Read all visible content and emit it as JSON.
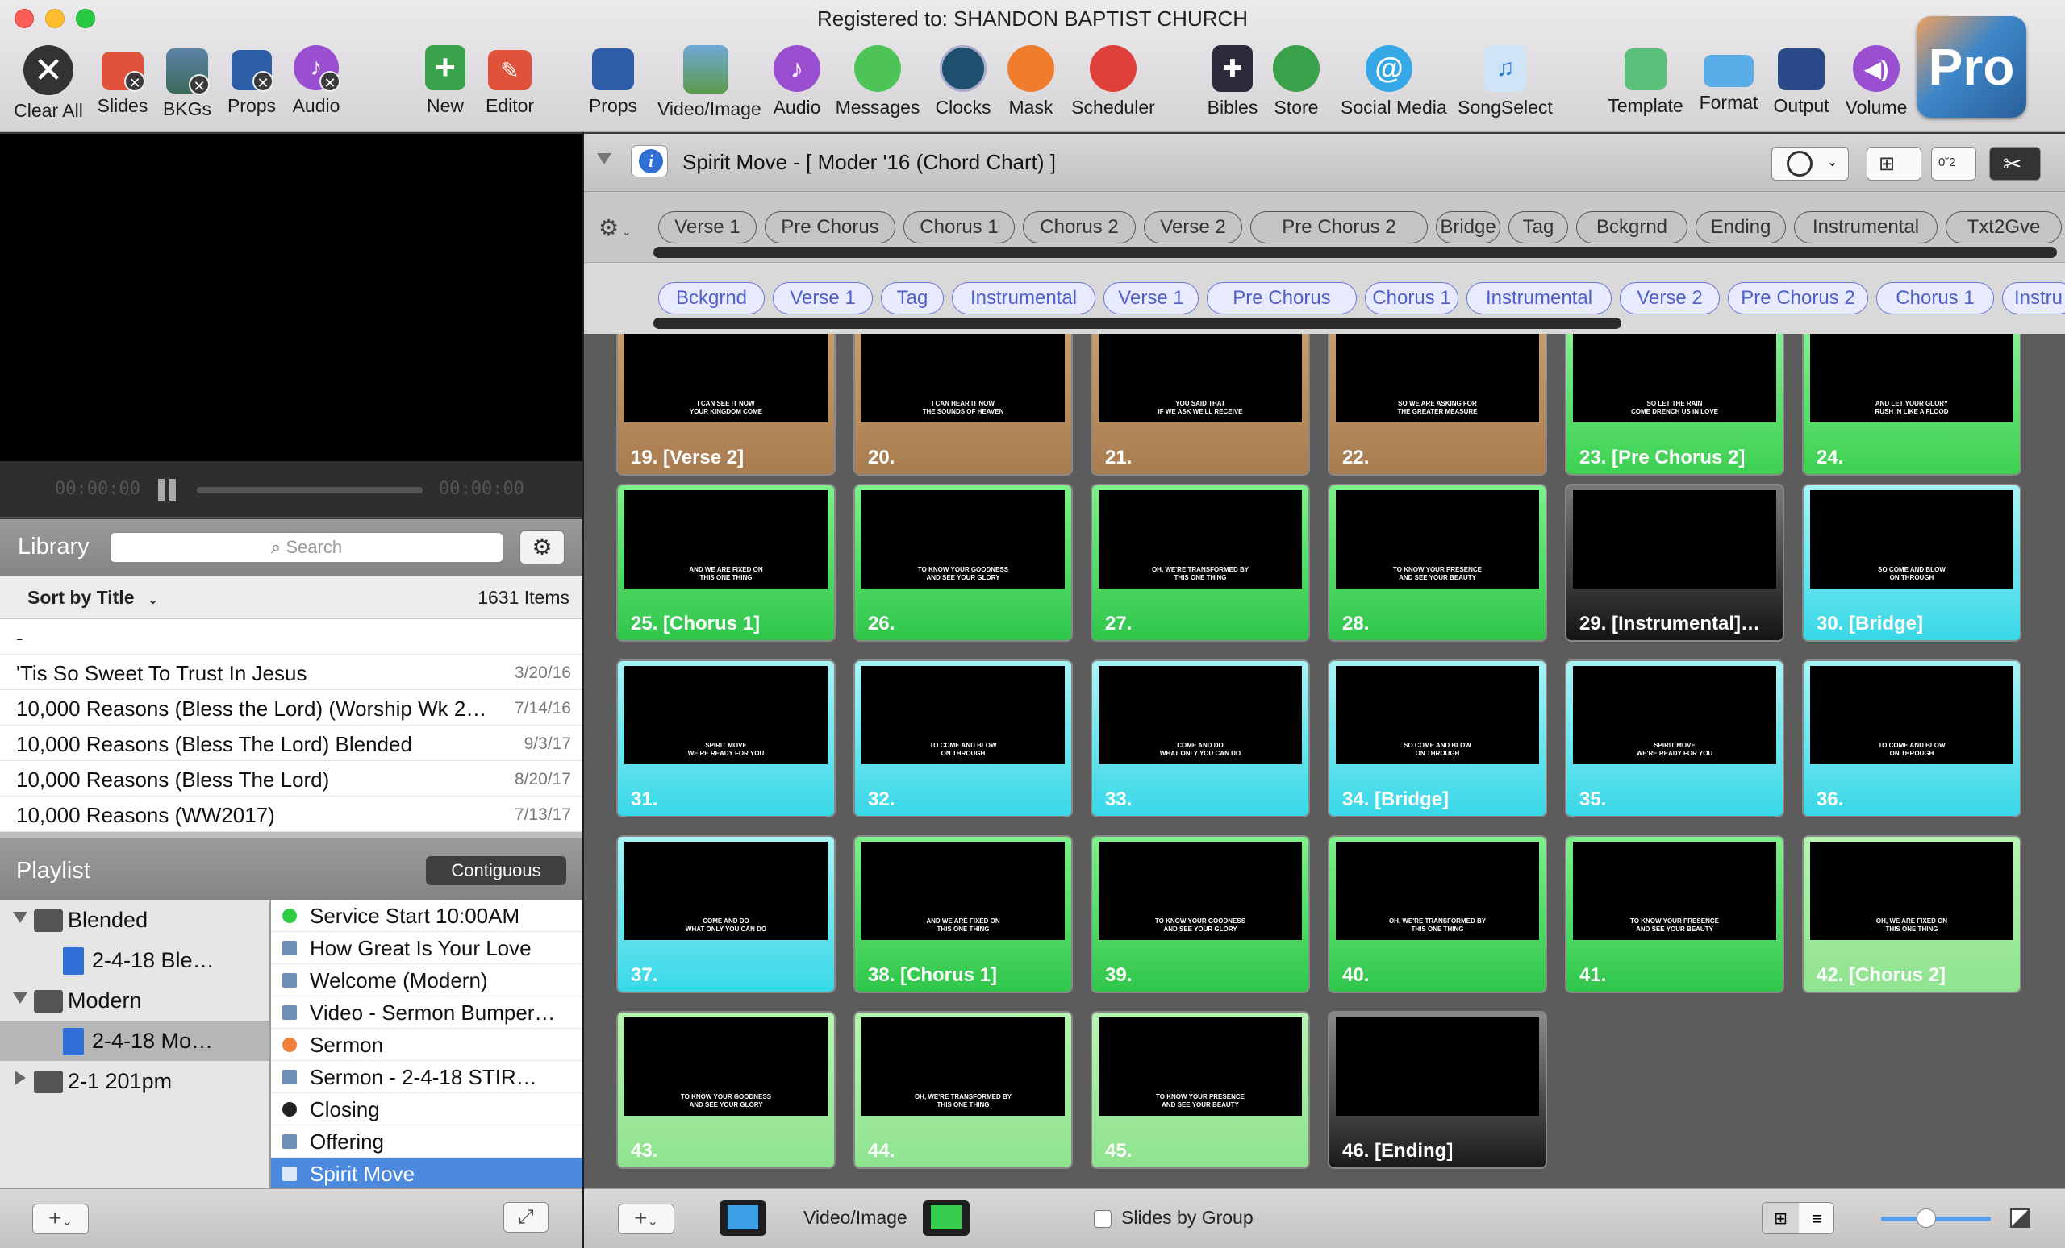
{
  "window": {
    "title": "Registered to: SHANDON BAPTIST CHURCH",
    "brand": "Pro"
  },
  "toolbar": {
    "clear_all": "Clear All",
    "slides": "Slides",
    "bkgs": "BKGs",
    "props": "Props",
    "audio": "Audio",
    "new": "New",
    "editor": "Editor",
    "props2": "Props",
    "video_image": "Video/Image",
    "audio2": "Audio",
    "messages": "Messages",
    "clocks": "Clocks",
    "mask": "Mask",
    "scheduler": "Scheduler",
    "bibles": "Bibles",
    "store": "Store",
    "social_media": "Social Media",
    "songselect": "SongSelect",
    "template": "Template",
    "format": "Format",
    "output": "Output",
    "volume": "Volume"
  },
  "transport": {
    "time_left": "00:00:00",
    "time_right": "00:00:00"
  },
  "library": {
    "title": "Library",
    "search_placeholder": "Search",
    "sort_label": "Sort by Title",
    "count": "1631 Items",
    "items": [
      {
        "title": "-",
        "date": ""
      },
      {
        "title": "'Tis So Sweet To Trust In Jesus",
        "date": "3/20/16"
      },
      {
        "title": "10,000 Reasons (Bless the Lord) (Worship Wk 2…",
        "date": "7/14/16"
      },
      {
        "title": "10,000 Reasons (Bless The Lord) Blended",
        "date": "9/3/17"
      },
      {
        "title": "10,000 Reasons (Bless The Lord)",
        "date": "8/20/17"
      },
      {
        "title": "10,000 Reasons (WW2017)",
        "date": "7/13/17"
      }
    ]
  },
  "playlist": {
    "title": "Playlist",
    "mode": "Contiguous",
    "tree": [
      {
        "label": "Blended",
        "type": "folder"
      },
      {
        "label": "2-4-18 Ble…",
        "type": "doc"
      },
      {
        "label": "Modern",
        "type": "folder"
      },
      {
        "label": "2-4-18 Mo…",
        "type": "doc"
      },
      {
        "label": "2-1 201pm",
        "type": "folder"
      }
    ],
    "items": [
      {
        "label": "Service Start 10:00AM",
        "icon": "green-dot"
      },
      {
        "label": "How Great Is Your Love",
        "icon": "pro-doc"
      },
      {
        "label": "Welcome (Modern)",
        "icon": "pro-doc"
      },
      {
        "label": "Video - Sermon Bumper…",
        "icon": "pro-doc"
      },
      {
        "label": "Sermon",
        "icon": "orange-dot"
      },
      {
        "label": "Sermon - 2-4-18     STIR…",
        "icon": "pro-doc"
      },
      {
        "label": "Closing",
        "icon": "black-dot"
      },
      {
        "label": "Offering",
        "icon": "pro-doc"
      },
      {
        "label": "Spirit Move",
        "icon": "pro-doc"
      }
    ]
  },
  "document": {
    "title": "Spirit Move - [ Moder '16 (Chord Chart) ]"
  },
  "groups_row1": [
    "Verse 1",
    "Pre Chorus",
    "Chorus 1",
    "Chorus 2",
    "Verse 2",
    "Pre Chorus 2",
    "Bridge",
    "Tag",
    "Bckgrnd",
    "Ending",
    "Instrumental",
    "Txt2Gve"
  ],
  "groups_row2": [
    "Bckgrnd",
    "Verse 1",
    "Tag",
    "Instrumental",
    "Verse 1",
    "Pre Chorus",
    "Chorus 1",
    "Instrumental",
    "Verse 2",
    "Pre Chorus 2",
    "Chorus 1",
    "Instru"
  ],
  "slides": [
    {
      "label": "19. [Verse 2]",
      "text": "I CAN SEE IT NOW\nYOUR KINGDOM COME",
      "group": "verse"
    },
    {
      "label": "20.",
      "text": "I CAN HEAR IT NOW\nTHE SOUNDS OF HEAVEN",
      "group": "verse"
    },
    {
      "label": "21.",
      "text": "YOU SAID THAT\nIF WE ASK WE'LL RECEIVE",
      "group": "verse"
    },
    {
      "label": "22.",
      "text": "SO WE ARE ASKING FOR\nTHE GREATER MEASURE",
      "group": "verse"
    },
    {
      "label": "23. [Pre Chorus 2]",
      "text": "SO LET THE RAIN\nCOME DRENCH US IN LOVE",
      "group": "pre"
    },
    {
      "label": "24.",
      "text": "AND LET YOUR GLORY\nRUSH IN LIKE A FLOOD",
      "group": "pre"
    },
    {
      "label": "25. [Chorus 1]",
      "text": "AND WE ARE FIXED ON\nTHIS ONE THING",
      "group": "chorus"
    },
    {
      "label": "26.",
      "text": "TO KNOW YOUR GOODNESS\nAND SEE YOUR GLORY",
      "group": "chorus"
    },
    {
      "label": "27.",
      "text": "OH, WE'RE TRANSFORMED BY\nTHIS ONE THING",
      "group": "chorus"
    },
    {
      "label": "28.",
      "text": "TO KNOW YOUR PRESENCE\nAND SEE YOUR BEAUTY",
      "group": "chorus"
    },
    {
      "label": "29. [Instrumental]…",
      "text": "",
      "group": "instr"
    },
    {
      "label": "30. [Bridge]",
      "text": "SO COME AND BLOW\nON THROUGH",
      "group": "bridge"
    },
    {
      "label": "31.",
      "text": "SPIRIT MOVE\nWE'RE READY FOR YOU",
      "group": "bridge"
    },
    {
      "label": "32.",
      "text": "TO COME AND BLOW\nON THROUGH",
      "group": "bridge"
    },
    {
      "label": "33.",
      "text": "COME AND DO\nWHAT ONLY YOU CAN DO",
      "group": "bridge"
    },
    {
      "label": "34. [Bridge]",
      "text": "SO COME AND BLOW\nON THROUGH",
      "group": "bridge"
    },
    {
      "label": "35.",
      "text": "SPIRIT MOVE\nWE'RE READY FOR YOU",
      "group": "bridge"
    },
    {
      "label": "36.",
      "text": "TO COME AND BLOW\nON THROUGH",
      "group": "bridge"
    },
    {
      "label": "37.",
      "text": "COME AND DO\nWHAT ONLY YOU CAN DO",
      "group": "bridge"
    },
    {
      "label": "38. [Chorus 1]",
      "text": "AND WE ARE FIXED ON\nTHIS ONE THING",
      "group": "chorus"
    },
    {
      "label": "39.",
      "text": "TO KNOW YOUR GOODNESS\nAND SEE YOUR GLORY",
      "group": "chorus"
    },
    {
      "label": "40.",
      "text": "OH, WE'RE TRANSFORMED BY\nTHIS ONE THING",
      "group": "chorus"
    },
    {
      "label": "41.",
      "text": "TO KNOW YOUR PRESENCE\nAND SEE YOUR BEAUTY",
      "group": "chorus"
    },
    {
      "label": "42. [Chorus 2]",
      "text": "OH, WE ARE FIXED ON\nTHIS ONE THING",
      "group": "chorus2"
    },
    {
      "label": "43.",
      "text": "TO KNOW YOUR GOODNESS\nAND SEE YOUR GLORY",
      "group": "chorus2"
    },
    {
      "label": "44.",
      "text": "OH, WE'RE TRANSFORMED BY\nTHIS ONE THING",
      "group": "chorus2"
    },
    {
      "label": "45.",
      "text": "TO KNOW YOUR PRESENCE\nAND SEE YOUR BEAUTY",
      "group": "chorus2"
    },
    {
      "label": "46. [Ending]",
      "text": "",
      "group": "end"
    }
  ],
  "footer": {
    "video_image": "Video/Image",
    "slides_by_group": "Slides by Group",
    "slides_by_group_checked": false
  },
  "colors": {
    "verse": "#b48a5e",
    "chorus": "#36cc4e",
    "pre_chorus": "#3cd050",
    "chorus2": "#8ee38e",
    "bridge": "#38d8e8",
    "instrumental": "#1e1e1e",
    "accent": "#4d8fe6",
    "selection": "#4c8ae0"
  }
}
